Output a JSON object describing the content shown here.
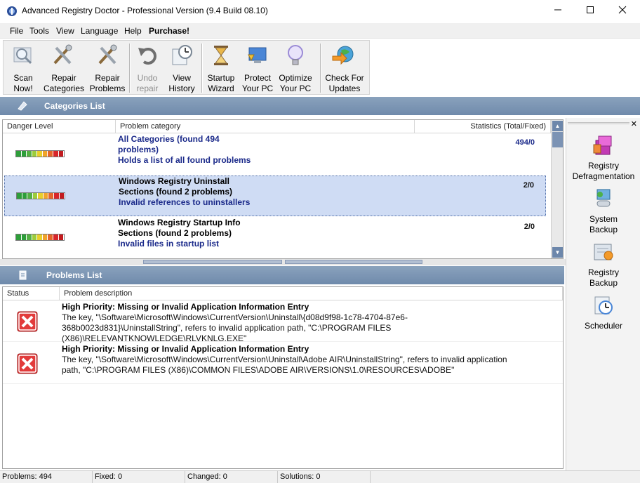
{
  "window": {
    "title": "Advanced Registry Doctor - Professional Version (9.4 Build 08.10)"
  },
  "menu": [
    "File",
    "Tools",
    "View",
    "Language",
    "Help",
    "Purchase!"
  ],
  "toolbar": [
    {
      "l1": "Scan",
      "l2": "Now!",
      "icon": "magnifier-icon",
      "disabled": false
    },
    {
      "l1": "Repair",
      "l2": "Categories",
      "icon": "tools-icon",
      "disabled": false
    },
    {
      "l1": "Repair",
      "l2": "Problems",
      "icon": "tools-icon",
      "disabled": false
    },
    {
      "l1": "Undo",
      "l2": "repair",
      "icon": "undo-icon",
      "disabled": true
    },
    {
      "l1": "View",
      "l2": "History",
      "icon": "history-icon",
      "disabled": false
    },
    {
      "l1": "Startup",
      "l2": "Wizard",
      "icon": "hourglass-icon",
      "disabled": false
    },
    {
      "l1": "Protect",
      "l2": "Your PC",
      "icon": "monitor-shield-icon",
      "disabled": false
    },
    {
      "l1": "Optimize",
      "l2": "Your PC",
      "icon": "lightbulb-icon",
      "disabled": false
    },
    {
      "l1": "Check For",
      "l2": "Updates",
      "icon": "globe-icon",
      "disabled": false
    }
  ],
  "categories_panel": {
    "title": "Categories List",
    "columns": [
      "Danger Level",
      "Problem category",
      "Statistics (Total/Fixed)"
    ],
    "rows": [
      {
        "title": "All Categories (found 494 problems)",
        "desc": "Holds a list of all found problems",
        "stats": "494/0",
        "selected": false
      },
      {
        "title": "Windows Registry Uninstall Sections (found 2 problems)",
        "desc": "Invalid references to uninstallers",
        "stats": "2/0",
        "selected": true
      },
      {
        "title": "Windows Registry Startup Info Sections (found 2 problems)",
        "desc": "Invalid files in startup list",
        "stats": "2/0",
        "selected": false
      }
    ]
  },
  "problems_panel": {
    "title": "Problems List",
    "columns": [
      "Status",
      "Problem description"
    ],
    "rows": [
      {
        "title": "High Priority: Missing or Invalid Application Information Entry",
        "desc": "The key, \"\\Software\\Microsoft\\Windows\\CurrentVersion\\Uninstall\\{d08d9f98-1c78-4704-87e6-368b0023d831}\\UninstallString\", refers to invalid application path, \"C:\\PROGRAM FILES (X86)\\RELEVANTKNOWLEDGE\\RLVKNLG.EXE\""
      },
      {
        "title": "High Priority: Missing or Invalid Application Information Entry",
        "desc": "The key, \"\\Software\\Microsoft\\Windows\\CurrentVersion\\Uninstall\\Adobe AIR\\UninstallString\", refers to invalid application path, \"C:\\PROGRAM FILES (X86)\\COMMON FILES\\ADOBE AIR\\VERSIONS\\1.0\\RESOURCES\\ADOBE\""
      }
    ]
  },
  "sidebar": [
    {
      "l1": "Registry",
      "l2": "Defragmentation",
      "icon": "defrag-icon"
    },
    {
      "l1": "System",
      "l2": "Backup",
      "icon": "system-backup-icon"
    },
    {
      "l1": "Registry",
      "l2": "Backup",
      "icon": "registry-backup-icon"
    },
    {
      "l1": "Scheduler",
      "l2": "",
      "icon": "scheduler-icon"
    }
  ],
  "status": {
    "problems": "Problems: 494",
    "fixed": "Fixed: 0",
    "changed": "Changed: 0",
    "solutions": "Solutions: 0"
  },
  "colors": {
    "meter": [
      "#2e9e3a",
      "#2e9e3a",
      "#54b043",
      "#9ccc3b",
      "#e8cf2a",
      "#f0a42a",
      "#e5652a",
      "#d8262a",
      "#c21b1f"
    ],
    "panel_header": "#6f8aab",
    "selection": "#cfdcf4"
  }
}
